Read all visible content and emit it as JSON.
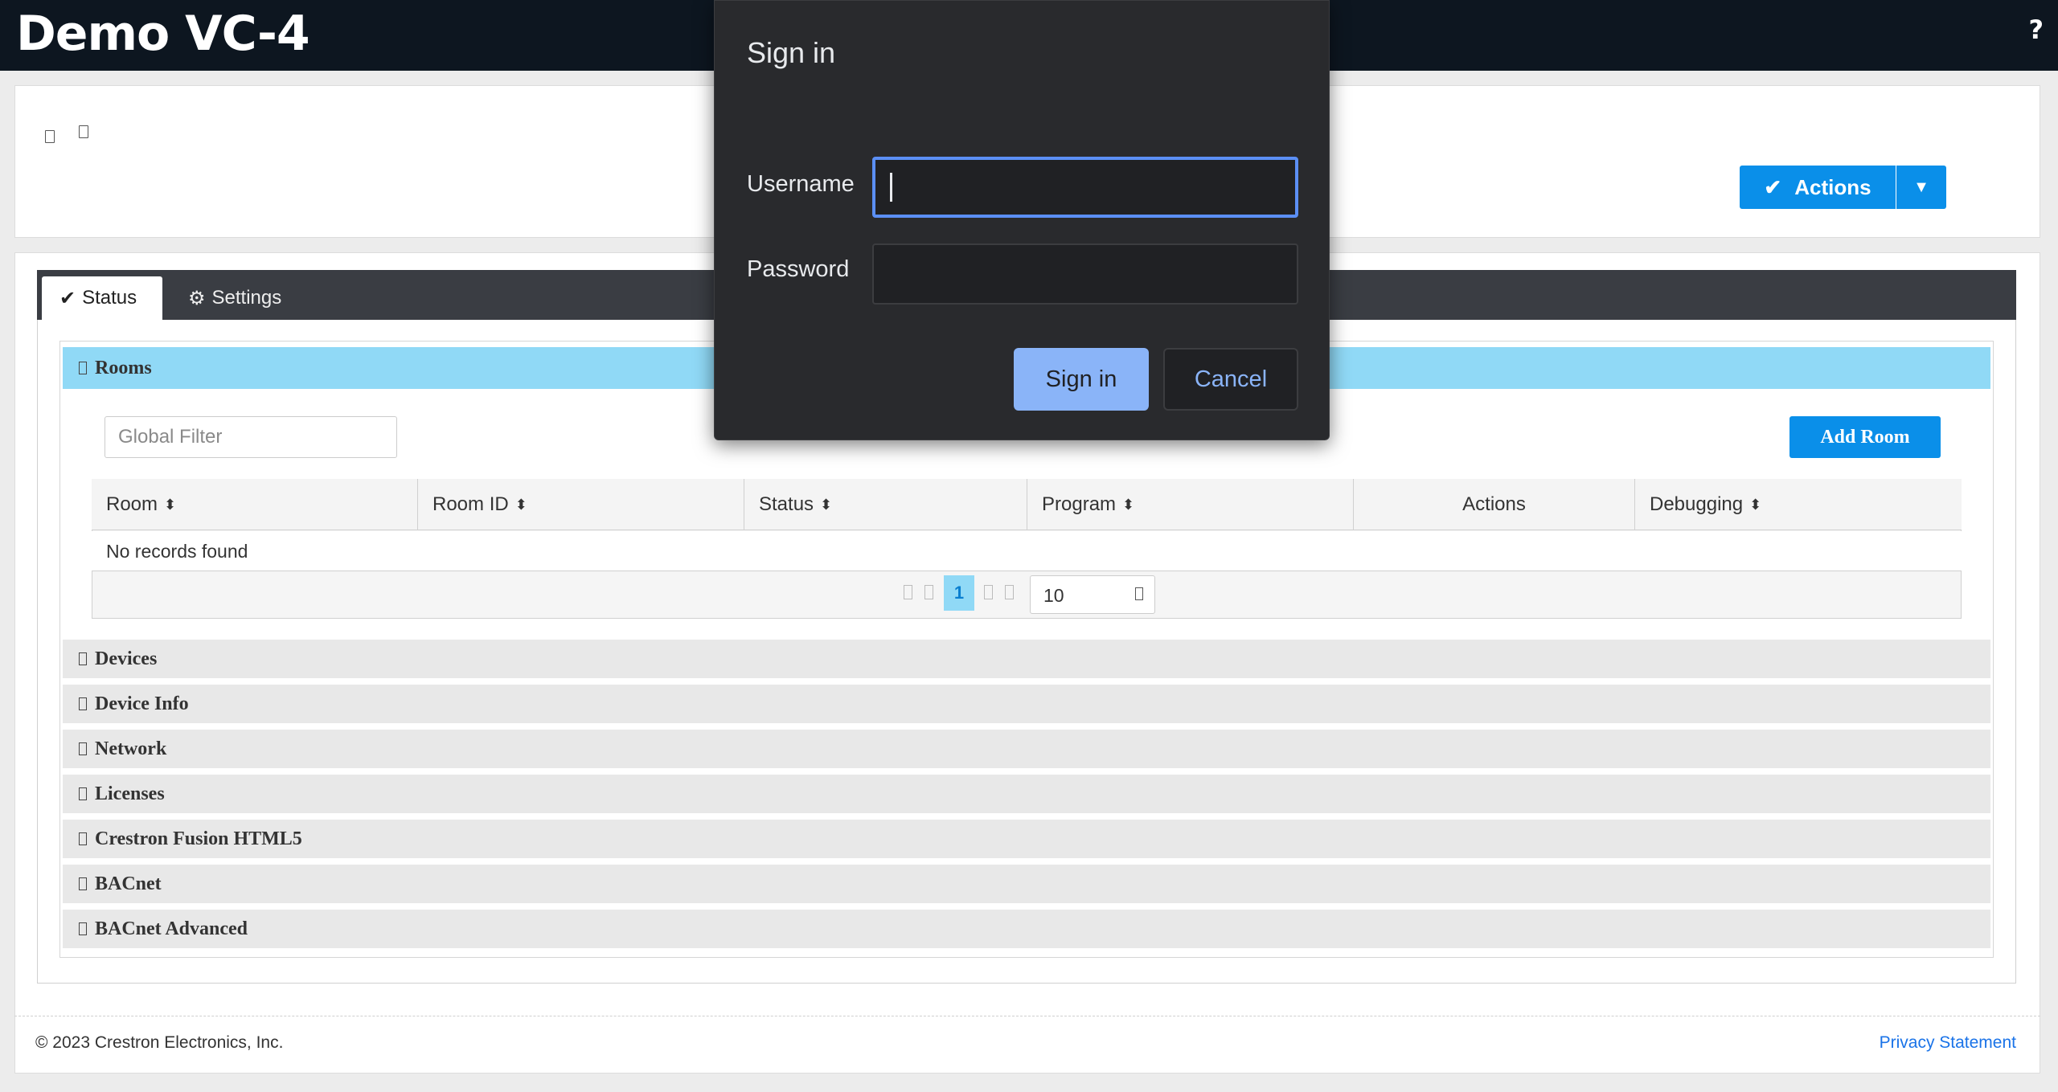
{
  "app": {
    "title": "Demo VC-4",
    "help_glyph": "?"
  },
  "header": {
    "actions_label": "Actions"
  },
  "tabs": [
    {
      "label": "Status",
      "icon": "check-icon"
    },
    {
      "label": "Settings",
      "icon": "gear-icon"
    }
  ],
  "rooms": {
    "title": "Rooms",
    "filter_placeholder": "Global Filter",
    "add_room_label": "Add Room",
    "columns": [
      "Room",
      "Room ID",
      "Status",
      "Program",
      "Actions",
      "Debugging"
    ],
    "empty_message": "No records found",
    "current_page": "1",
    "page_size": "10"
  },
  "sections": [
    "Devices",
    "Device Info",
    "Network",
    "Licenses",
    "Crestron Fusion HTML5",
    "BACnet",
    "BACnet Advanced"
  ],
  "footer": {
    "copyright": "© 2023 Crestron Electronics, Inc.",
    "privacy": "Privacy Statement"
  },
  "dialog": {
    "title": "Sign in",
    "username_label": "Username",
    "password_label": "Password",
    "username_value": "",
    "password_value": "",
    "signin_label": "Sign in",
    "cancel_label": "Cancel"
  },
  "colors": {
    "topbar": "#0d1620",
    "primary_button": "#0a8fe9",
    "accordion_active": "#90d9f6",
    "dialog_bg": "#292a2d",
    "dialog_accent": "#8ab4f8"
  }
}
